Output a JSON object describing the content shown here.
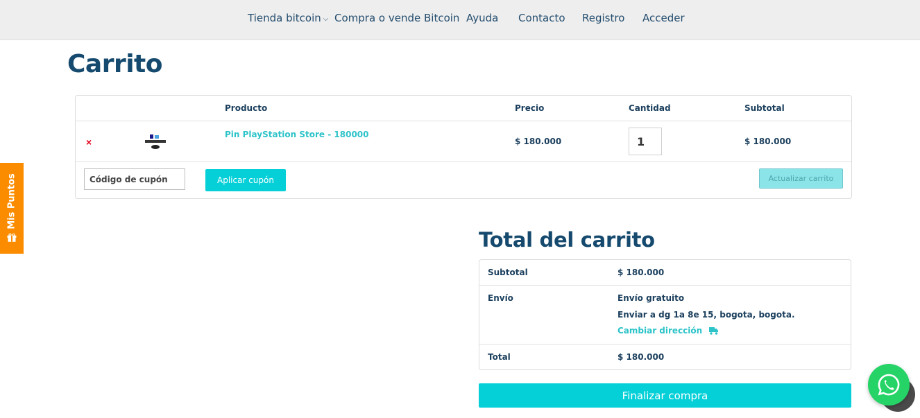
{
  "nav": {
    "items": [
      {
        "label": "Tienda bitcoin",
        "has_dropdown": true
      },
      {
        "label": "Compra o vende Bitcoin"
      },
      {
        "label": "Ayuda"
      },
      {
        "label": "Contacto"
      },
      {
        "label": "Registro"
      },
      {
        "label": "Acceder"
      }
    ]
  },
  "page": {
    "title": "Carrito"
  },
  "cart": {
    "columns": [
      "Producto",
      "Precio",
      "Cantidad",
      "Subtotal"
    ],
    "items": [
      {
        "remove_label": "×",
        "thumbnail_icon": "playstation-logo",
        "product": "Pin PlayStation Store - 180000",
        "price": "$ 180.000",
        "quantity": "1",
        "subtotal": "$ 180.000"
      }
    ],
    "coupon": {
      "placeholder": "Código de cupón",
      "value": ""
    },
    "apply_coupon_label": "Aplicar cupón",
    "update_cart_label": "Actualizar carrito"
  },
  "totals": {
    "title": "Total del carrito",
    "subtotal_label": "Subtotal",
    "subtotal_value": "$ 180.000",
    "shipping_label": "Envío",
    "shipping_method": "Envío gratuito",
    "shipping_address": "Enviar a dg 1a 8e 15, bogota, bogota.",
    "change_address_label": "Cambiar dirección",
    "total_label": "Total",
    "total_value": "$ 180.000",
    "checkout_label": "Finalizar compra"
  },
  "side_tab": {
    "label": "Mis Puntos",
    "icon": "gift-icon"
  },
  "colors": {
    "accent": "#05d0d8",
    "link": "#2cc3c9",
    "heading": "#154a6e",
    "side_tab": "#fb8c00",
    "remove": "#e2001a",
    "whatsapp": "#25d366"
  }
}
